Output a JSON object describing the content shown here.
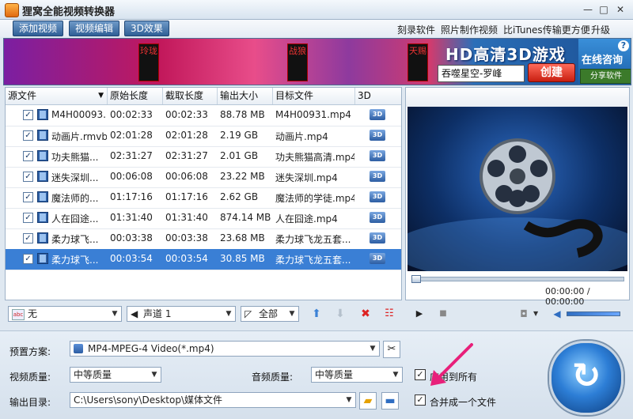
{
  "window": {
    "title": "狸窝全能视频转换器",
    "minimize": "—",
    "restore": "□",
    "close": "✕"
  },
  "toolbar": {
    "buttons": [
      "添加视频",
      "视频编辑",
      "3D效果"
    ],
    "links": [
      "刻录软件",
      "照片制作视频",
      "比iTunes传输更方便",
      "升级"
    ]
  },
  "banner": {
    "tags": [
      "玲珑",
      "战狼",
      "天赐"
    ],
    "headline": "HD高清3D游戏",
    "game_name": "吞噬星空-罗峰",
    "create_label": "创建",
    "online_label": "在线咨询",
    "share_label": "分享软件",
    "help": "?"
  },
  "filelist": {
    "headers": [
      "源文件",
      "原始长度",
      "截取长度",
      "输出大小",
      "目标文件",
      "3D"
    ],
    "rows": [
      [
        "M4H00093...",
        "00:02:33",
        "00:02:33",
        "88.78 MB",
        "M4H00931.mp4"
      ],
      [
        "动画片.rmvb",
        "02:01:28",
        "02:01:28",
        "2.19 GB",
        "动画片.mp4"
      ],
      [
        "功夫熊猫...",
        "02:31:27",
        "02:31:27",
        "2.01 GB",
        "功夫熊猫高清.mp4"
      ],
      [
        "迷失深圳...",
        "00:06:08",
        "00:06:08",
        "23.22 MB",
        "迷失深圳.mp4"
      ],
      [
        "魔法师的...",
        "01:17:16",
        "01:17:16",
        "2.62 GB",
        "魔法师的学徒.mp4"
      ],
      [
        "人在囧途...",
        "01:31:40",
        "01:31:40",
        "874.14 MB",
        "人在囧途.mp4"
      ],
      [
        "柔力球飞...",
        "00:03:38",
        "00:03:38",
        "23.68 MB",
        "柔力球飞龙五套..."
      ],
      [
        "柔力球飞...",
        "00:03:54",
        "00:03:54",
        "30.85 MB",
        "柔力球飞龙五套..."
      ]
    ],
    "selected_index": 7,
    "icon_3d": "3D"
  },
  "preview": {
    "timecode": "00:00:00 / 00:00:00"
  },
  "controls": {
    "subtitle": "无",
    "audio_track": "声道 1",
    "scope": "全部"
  },
  "settings": {
    "preset_label": "预置方案:",
    "preset_value": "MP4-MPEG-4 Video(*.mp4)",
    "video_quality_label": "视频质量:",
    "video_quality_value": "中等质量",
    "audio_quality_label": "音频质量:",
    "audio_quality_value": "中等质量",
    "apply_all_label": "应用到所有",
    "output_label": "输出目录:",
    "output_value": "C:\\Users\\sony\\Desktop\\媒体文件",
    "merge_label": "合并成一个文件"
  },
  "colors": {
    "accent": "#2f5f96",
    "selection": "#3a7fd5",
    "arrow": "#e8207a"
  }
}
